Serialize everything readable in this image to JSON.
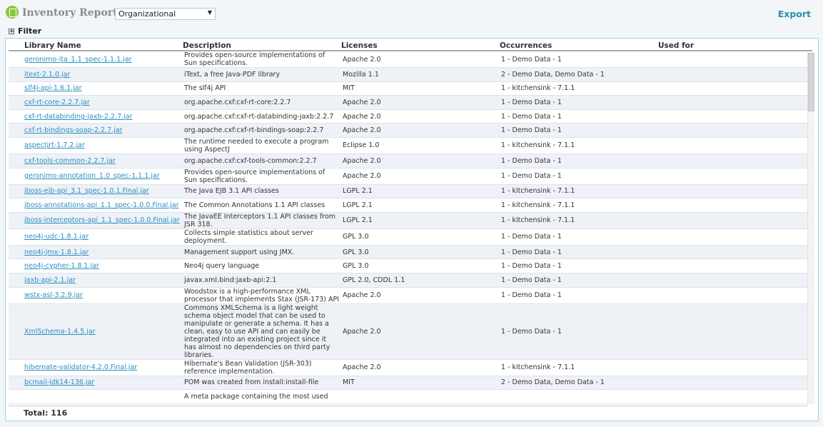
{
  "header": {
    "title": "Inventory Report",
    "view_select": "Organizational",
    "export_label": "Export"
  },
  "filter": {
    "label": "Filter"
  },
  "table": {
    "columns": [
      "Library Name",
      "Description",
      "Licenses",
      "Occurrences",
      "Used for"
    ],
    "rows": [
      [
        "geronimo-jta_1.1_spec-1.1.1.jar",
        "Provides open-source implementations of Sun specifications.",
        "Apache 2.0",
        "1 - Demo Data - 1",
        ""
      ],
      [
        "itext-2.1.0.jar",
        "iText, a free Java-PDF library",
        "Mozilla 1.1",
        "2 - Demo Data, Demo Data - 1",
        ""
      ],
      [
        "slf4j-api-1.6.1.jar",
        "The slf4j API",
        "MIT",
        "1 - kitchensink - 7.1.1",
        ""
      ],
      [
        "cxf-rt-core-2.2.7.jar",
        "org.apache.cxf:cxf-rt-core:2.2.7",
        "Apache 2.0",
        "1 - Demo Data - 1",
        ""
      ],
      [
        "cxf-rt-databinding-jaxb-2.2.7.jar",
        "org.apache.cxf:cxf-rt-databinding-jaxb:2.2.7",
        "Apache 2.0",
        "1 - Demo Data - 1",
        ""
      ],
      [
        "cxf-rt-bindings-soap-2.2.7.jar",
        "org.apache.cxf:cxf-rt-bindings-soap:2.2.7",
        "Apache 2.0",
        "1 - Demo Data - 1",
        ""
      ],
      [
        "aspectjrt-1.7.2.jar",
        "The runtime needed to execute a program using AspectJ",
        "Eclipse 1.0",
        "1 - kitchensink - 7.1.1",
        ""
      ],
      [
        "cxf-tools-common-2.2.7.jar",
        "org.apache.cxf:cxf-tools-common:2.2.7",
        "Apache 2.0",
        "1 - Demo Data - 1",
        ""
      ],
      [
        "geronimo-annotation_1.0_spec-1.1.1.jar",
        "Provides open-source implementations of Sun specifications.",
        "Apache 2.0",
        "1 - Demo Data - 1",
        ""
      ],
      [
        "jboss-ejb-api_3.1_spec-1.0.1.Final.jar",
        "The Java EJB 3.1 API classes",
        "LGPL 2.1",
        "1 - kitchensink - 7.1.1",
        ""
      ],
      [
        "jboss-annotations-api_1.1_spec-1.0.0.Final.jar",
        "The Common Annotations 1.1 API classes",
        "LGPL 2.1",
        "1 - kitchensink - 7.1.1",
        ""
      ],
      [
        "jboss-interceptors-api_1.1_spec-1.0.0.Final.jar",
        "The JavaEE Interceptors 1.1 API classes from JSR 318.",
        "LGPL 2.1",
        "1 - kitchensink - 7.1.1",
        ""
      ],
      [
        "neo4j-udc-1.8.1.jar",
        "Collects simple statistics about server deployment.",
        "GPL 3.0",
        "1 - Demo Data - 1",
        ""
      ],
      [
        "neo4j-jmx-1.8.1.jar",
        "Management support using JMX.",
        "GPL 3.0",
        "1 - Demo Data - 1",
        ""
      ],
      [
        "neo4j-cypher-1.8.1.jar",
        "Neo4j query language",
        "GPL 3.0",
        "1 - Demo Data - 1",
        ""
      ],
      [
        "jaxb-api-2.1.jar",
        "javax.xml.bind:jaxb-api:2.1",
        "GPL 2.0, CDDL 1.1",
        "1 - Demo Data - 1",
        ""
      ],
      [
        "wstx-asl-3.2.9.jar",
        "Woodstox is a high-performance XML processor that implements Stax (JSR-173) API",
        "Apache 2.0",
        "1 - Demo Data - 1",
        ""
      ],
      [
        "XmlSchema-1.4.5.jar",
        "Commons XMLSchema is a light weight schema object model that can be used to manipulate or generate a schema. It has a clean, easy to use API and can easily be integrated into an existing project since it has almost no dependencies on third party libraries.",
        "Apache 2.0",
        "1 - Demo Data - 1",
        ""
      ],
      [
        "hibernate-validator-4.2.0.Final.jar",
        "Hibernate's Bean Validation (JSR-303) reference implementation.",
        "Apache 2.0",
        "1 - kitchensink - 7.1.1",
        ""
      ],
      [
        "bcmail-jdk14-136.jar",
        "POM was created from install:install-file",
        "MIT",
        "2 - Demo Data, Demo Data - 1",
        ""
      ],
      [
        "",
        "A meta package containing the most used",
        "",
        "",
        ""
      ]
    ]
  },
  "footer": {
    "total": "Total: 116"
  }
}
